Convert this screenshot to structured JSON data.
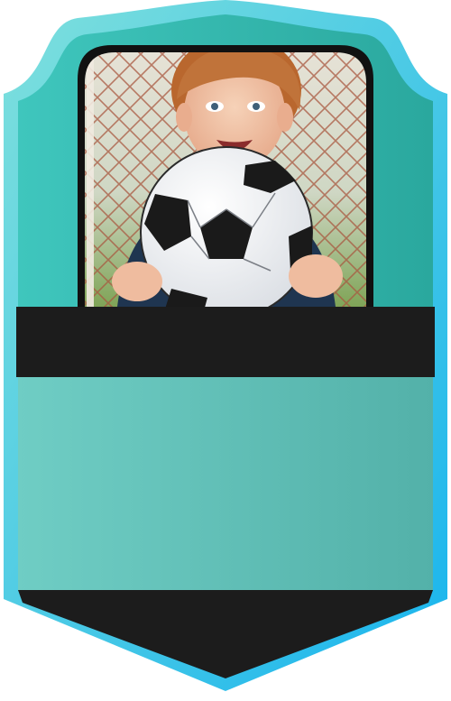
{
  "card": {
    "colors": {
      "frame_outer_start": "#7fe0dc",
      "frame_outer_end": "#18b4ee",
      "frame_inner_start": "#3fc6bd",
      "frame_inner_end": "#2aa89e",
      "photo_border": "#111111",
      "name_band": "#1c1c1c",
      "stats_panel_start": "#6fcdc4",
      "stats_panel_end": "#53b1a9",
      "bottom_tip": "#1c1c1c"
    },
    "photo": {
      "subject": "boy-holding-soccer-ball",
      "background": "soccer-goal-net"
    }
  }
}
